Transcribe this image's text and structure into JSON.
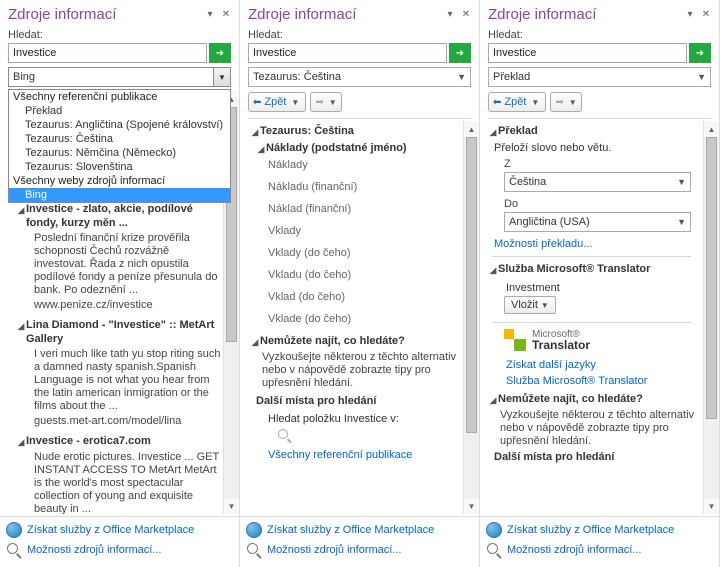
{
  "common": {
    "pane_title": "Zdroje informací",
    "search_label": "Hledat:",
    "search_value": "Investice",
    "back_label": "Zpět",
    "footer_marketplace": "Získat služby z Office Marketplace",
    "footer_options": "Možnosti zdrojů informací..."
  },
  "pane1": {
    "selected_source": "Bing",
    "dropdown": {
      "group1_header": "Všechny referenční publikace",
      "group1_items": [
        "Překlad",
        "Tezaurus: Angličtina (Spojené království)",
        "Tezaurus: Čeština",
        "Tezaurus: Němčina (Německo)",
        "Tezaurus: Slovenština"
      ],
      "group2_header": "Všechny weby zdrojů informací",
      "group2_items": [
        "Bing"
      ]
    },
    "results": [
      {
        "title": "Investice - zlato, akcie, podílové fondy, kurzy měn ...",
        "body": "Poslední finanční krize prověřila schopnosti Čechů rozvážně investovat. Řada z nich opustila podílové fondy a peníze přesunula do bank. Po odeznění ...",
        "link": "www.penize.cz/investice"
      },
      {
        "title": "Lina Diamond - \"Investice\" :: MetArt Gallery",
        "body": "I veri much like tath yu stop riting such a damned nasty spanish.Spanish Language is not what you hear from the latin american inmigration or the films about the ...",
        "link": "guests.met-art.com/model/lina"
      },
      {
        "title": "Investice - erotica7.com",
        "body": "Nude erotic pictures. Investice ... GET INSTANT ACCESS TO MetArt MetArt is the world's most spectacular collection of young and exquisite beauty in ..."
      }
    ]
  },
  "pane2": {
    "selected_source": "Tezaurus: Čeština",
    "tree_root": "Tezaurus: Čeština",
    "tree_sub": "Náklady (podstatné jméno)",
    "entries": [
      "Náklady",
      "Nákladu (finanční)",
      "Náklad (finanční)",
      "Vklady",
      "Vklady (do čeho)",
      "Vkladu (do čeho)",
      "Vklad (do čeho)",
      "Vklade (do čeho)"
    ],
    "notfound_header": "Nemůžete najít, co hledáte?",
    "notfound_body": "Vyzkoušejte některou z těchto alternativ nebo v nápovědě zobrazte tipy pro upřesnění hledání.",
    "other_places": "Další místa pro hledání",
    "search_in": "Hledat položku Investice v:",
    "all_ref": "Všechny referenční publikace"
  },
  "pane3": {
    "selected_source": "Překlad",
    "tree_root": "Překlad",
    "intro": "Přeloží slovo nebo větu.",
    "from_label": "Z",
    "from_value": "Čeština",
    "to_label": "Do",
    "to_value": "Angličtina (USA)",
    "options_link": "Možnosti překladu...",
    "service_header": "Služba Microsoft® Translator",
    "result": "Investment",
    "insert_label": "Vložit",
    "logo_small": "Microsoft®",
    "logo_big": "Translator",
    "more_langs": "Získat další jazyky",
    "service_link": "Služba Microsoft® Translator",
    "notfound_header": "Nemůžete najít, co hledáte?",
    "notfound_body": "Vyzkoušejte některou z těchto alternativ nebo v nápovědě zobrazte tipy pro upřesnění hledání.",
    "other_places": "Další místa pro hledání"
  }
}
